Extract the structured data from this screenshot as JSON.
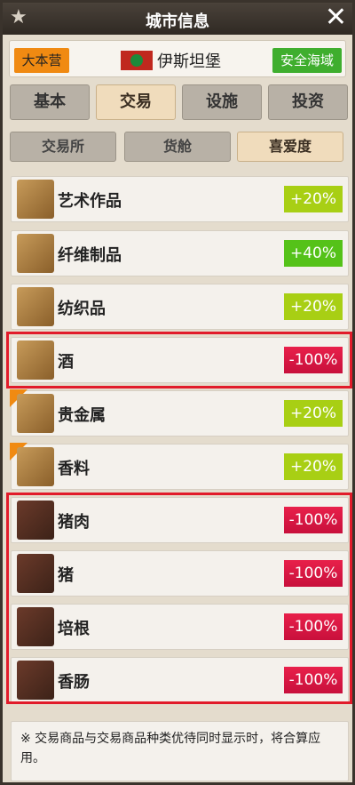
{
  "title": "城市信息",
  "city": {
    "port_badge": "大本营",
    "name": "伊斯坦堡",
    "safety": "安全海域"
  },
  "tabs": [
    "基本",
    "交易",
    "设施",
    "投资"
  ],
  "subtabs": [
    "交易所",
    "货舱",
    "喜爱度"
  ],
  "goods": [
    {
      "name": "艺术作品",
      "value": "+20%",
      "icon": "art-scroll-icon"
    },
    {
      "name": "纤维制品",
      "value": "+40%",
      "icon": "fiber-scroll-icon"
    },
    {
      "name": "纺织品",
      "value": "+20%",
      "icon": "textile-scroll-icon"
    },
    {
      "name": "酒",
      "value": "-100%",
      "icon": "wine-scroll-icon"
    },
    {
      "name": "贵金属",
      "value": "+20%",
      "icon": "metal-scroll-icon"
    },
    {
      "name": "香料",
      "value": "+20%",
      "icon": "spice-scroll-icon"
    },
    {
      "name": "猪肉",
      "value": "-100%",
      "icon": "pork-icon"
    },
    {
      "name": "猪",
      "value": "-100%",
      "icon": "pig-icon"
    },
    {
      "name": "培根",
      "value": "-100%",
      "icon": "bacon-icon"
    },
    {
      "name": "香肠",
      "value": "-100%",
      "icon": "sausage-icon"
    }
  ],
  "note": "※ 交易商品与交易商品种类优待同时显示时，将合算应用。",
  "colors": {
    "positive": "#a8cf14",
    "positive_strong": "#55c219",
    "negative": "#e11b3c",
    "highlight": "#e11b2a"
  }
}
